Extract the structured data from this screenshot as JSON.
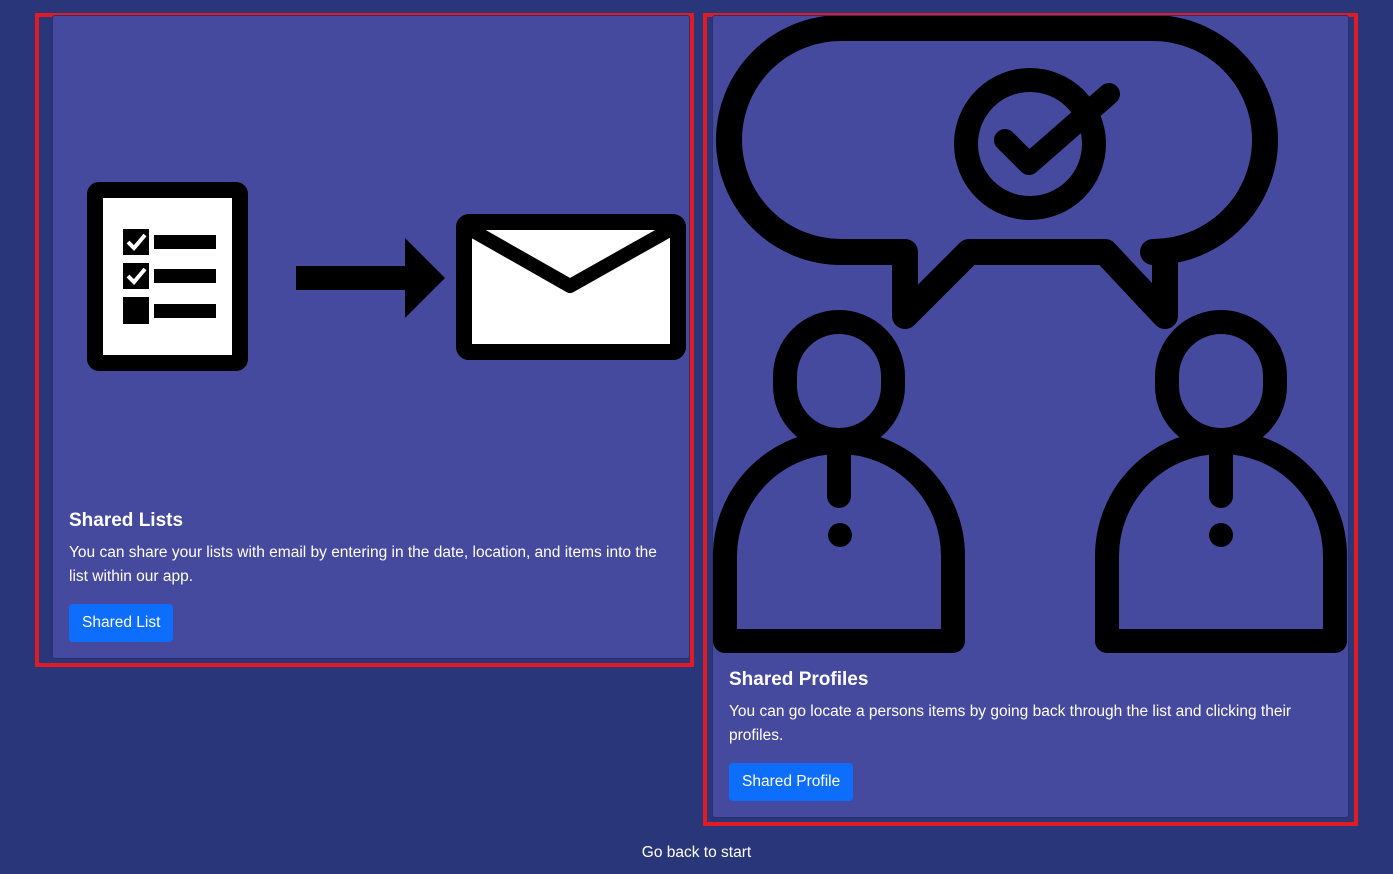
{
  "cards": [
    {
      "title": "Shared Lists",
      "text": "You can share your lists with email by entering in the date, location, and items into the list within our app.",
      "button_label": "Shared List",
      "image_icon": "checklist-to-envelope-icon"
    },
    {
      "title": "Shared Profiles",
      "text": "You can go locate a persons items by going back through the list and clicking their profiles.",
      "button_label": "Shared Profile",
      "image_icon": "two-people-speech-bubble-check-icon"
    }
  ],
  "footer": {
    "link_label": "Go back to start"
  },
  "colors": {
    "background": "#29367a",
    "card": "#464a9e",
    "button": "#0d6efd",
    "highlight_frame": "#e01b24"
  }
}
